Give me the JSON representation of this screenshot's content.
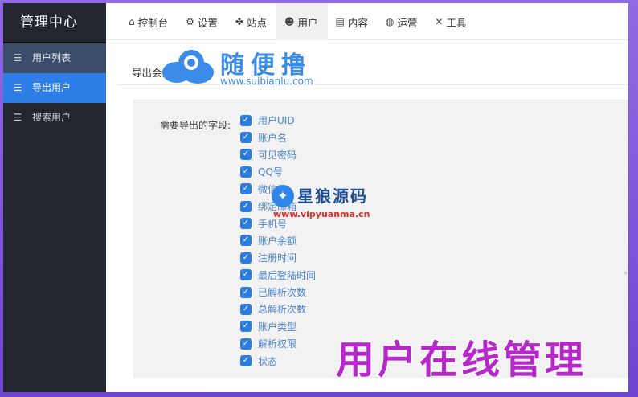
{
  "sidebar": {
    "brand": "管理中心",
    "items": [
      {
        "label": "用户列表",
        "icon": "list-icon"
      },
      {
        "label": "导出用户",
        "icon": "list-icon"
      },
      {
        "label": "搜索用户",
        "icon": "list-icon"
      }
    ]
  },
  "topnav": {
    "items": [
      {
        "label": "控制台",
        "icon": "home-icon"
      },
      {
        "label": "设置",
        "icon": "gear-icon"
      },
      {
        "label": "站点",
        "icon": "clover-icon"
      },
      {
        "label": "用户",
        "icon": "users-icon"
      },
      {
        "label": "内容",
        "icon": "file-icon"
      },
      {
        "label": "运营",
        "icon": "globe-icon"
      },
      {
        "label": "工具",
        "icon": "tools-icon"
      }
    ],
    "active": "用户"
  },
  "subtab": {
    "label": "导出会员"
  },
  "export_form": {
    "label": "需要导出的字段:",
    "fields": [
      "用户UID",
      "账户名",
      "可见密码",
      "QQ号",
      "微信号",
      "绑定邮箱",
      "手机号",
      "账户余额",
      "注册时间",
      "最后登陆时间",
      "已解析次数",
      "总解析次数",
      "账户类型",
      "解析权限",
      "状态"
    ]
  },
  "watermark1": {
    "title": "随便撸",
    "url": "www.suibianlu.com"
  },
  "watermark2": {
    "title": "星狼源码",
    "url": "www.vipyuanma.cn"
  },
  "banner": {
    "text": "用户在线管理"
  },
  "colors": {
    "accent": "#2d7ee6",
    "sidebar": "#23262e",
    "banner": "#b628c9"
  }
}
